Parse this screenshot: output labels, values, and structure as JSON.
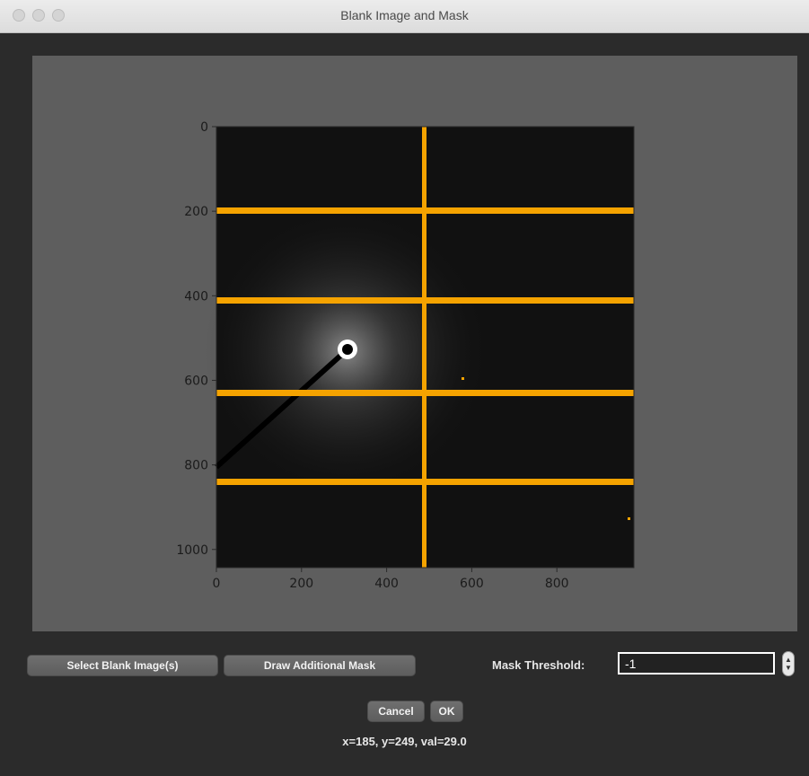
{
  "window": {
    "title": "Blank Image and Mask"
  },
  "plot": {
    "image_description": "detector-blank",
    "y_ticks": [
      "0",
      "200",
      "400",
      "600",
      "800",
      "1000"
    ],
    "x_ticks": [
      "0",
      "200",
      "400",
      "600",
      "800"
    ],
    "mask_color": "#f5a300",
    "background_color": "#5e5e5e"
  },
  "buttons": {
    "select_blank": "Select Blank Image(s)",
    "draw_mask": "Draw Additional Mask",
    "cancel": "Cancel",
    "ok": "OK"
  },
  "mask_threshold": {
    "label": "Mask Threshold:",
    "value": "-1"
  },
  "status": {
    "text": "x=185, y=249, val=29.0"
  }
}
